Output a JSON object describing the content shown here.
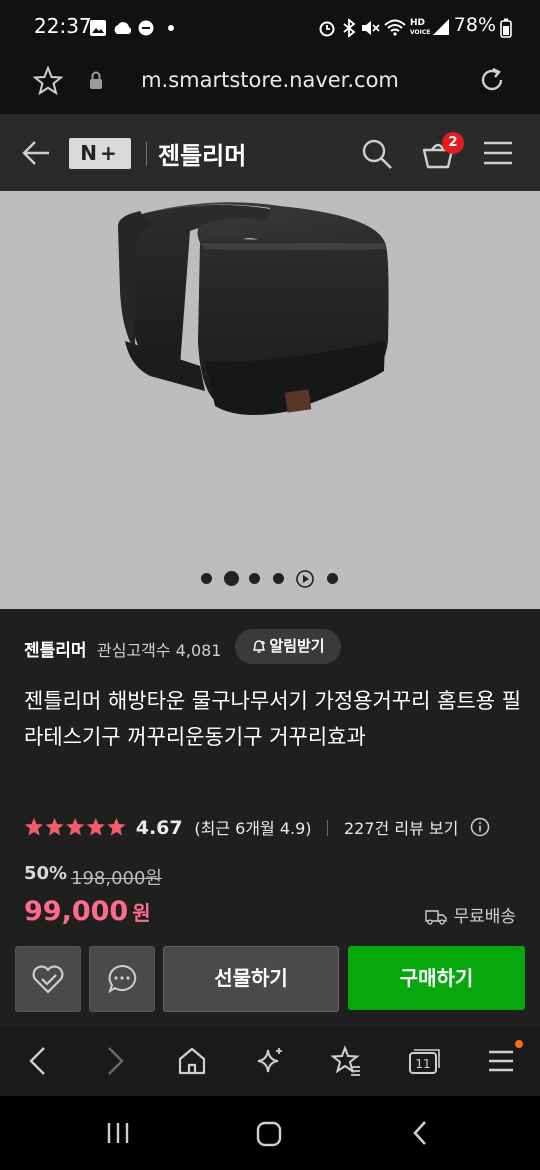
{
  "status_bar": {
    "time": "22:37",
    "battery": "78%"
  },
  "browser": {
    "url": "m.smartstore.naver.com"
  },
  "header": {
    "logo": "N+",
    "brand": "젠틀리머",
    "cart_count": "2"
  },
  "store": {
    "name": "젠틀리머",
    "followers_label": "관심고객수 4,081",
    "notify_label": "알림받기"
  },
  "product": {
    "title": "젠틀리머 해방타운 물구나무서기 가정용거꾸리 홈트용 필라테스기구 꺼꾸리운동기구 거꾸리효과",
    "rating": "4.67",
    "recent_rating": "(최근 6개월 4.9)",
    "review_link": "227건 리뷰 보기",
    "discount": "50%",
    "original_price": "198,000원",
    "price_number": "99,000",
    "price_unit": "원",
    "shipping": "무료배송"
  },
  "actions": {
    "gift": "선물하기",
    "buy": "구매하기"
  },
  "colors": {
    "price": "#ff6b8e",
    "buy": "#07a80e",
    "stars": "#f25d6b",
    "badge": "#e21b23"
  }
}
